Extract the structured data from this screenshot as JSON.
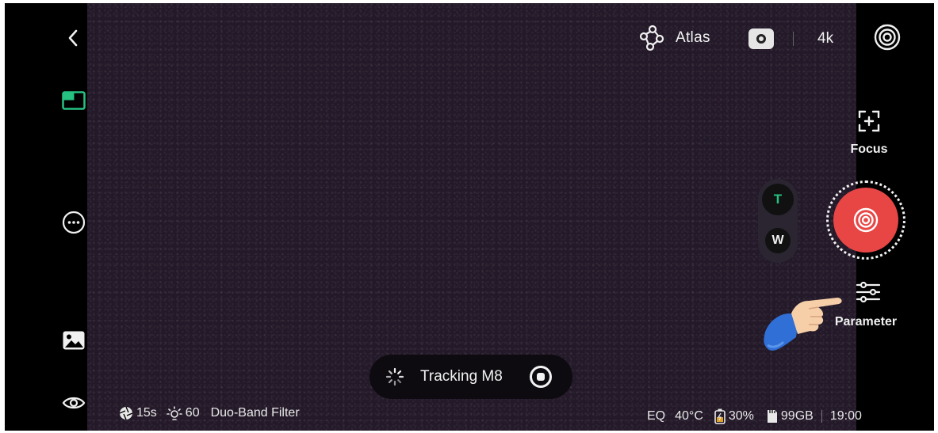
{
  "top_bar": {
    "atlas_label": "Atlas",
    "resolution": "4k"
  },
  "right_controls": {
    "focus_label": "Focus",
    "zoom_tele": "T",
    "zoom_wide": "W",
    "parameter_label": "Parameter"
  },
  "tracking": {
    "label": "Tracking M8"
  },
  "status_left": {
    "exposure": "15s",
    "gain": "60",
    "filter": "Duo-Band Filter"
  },
  "status_right": {
    "eq": "EQ",
    "temperature": "40°C",
    "battery": "30%",
    "storage": "99GB",
    "time": "19:00"
  },
  "colors": {
    "accent_green": "#26c281",
    "shutter_red": "#e84545",
    "viewfinder": "#231928"
  },
  "icons": [
    "back-icon",
    "layout-icon",
    "more-icon",
    "gallery-icon",
    "eye-icon",
    "atlas-icon",
    "camera-switch-icon",
    "focus-icon",
    "shutter-icon",
    "parameter-icon",
    "spinner-icon",
    "stop-icon",
    "aperture-icon",
    "sun-icon",
    "battery-icon",
    "sd-card-icon"
  ]
}
